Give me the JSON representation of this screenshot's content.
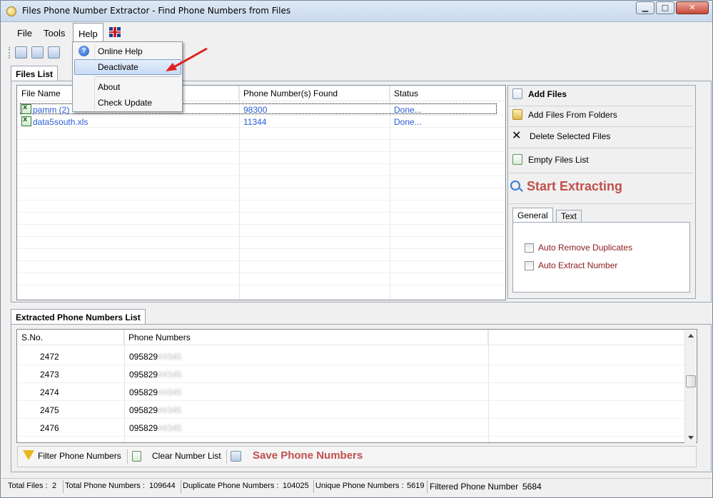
{
  "window": {
    "title": "Files Phone Number Extractor - Find Phone Numbers from Files",
    "min_glyph": "▁",
    "max_glyph": "□",
    "close_glyph": "✕"
  },
  "menu": {
    "file": "File",
    "tools": "Tools",
    "help": "Help",
    "language_icon": "uk-flag-icon"
  },
  "help_menu": {
    "items": [
      {
        "label": "Online Help",
        "icon": "help-icon"
      },
      {
        "label": "Deactivate",
        "highlighted": true
      },
      {
        "label": "About"
      },
      {
        "label": "Check Update"
      }
    ]
  },
  "files_list": {
    "tab_label": "Files List",
    "columns": [
      "File Name",
      "Phone Number(s) Found",
      "Status"
    ],
    "rows": [
      {
        "name": "pamm (2)",
        "found": "98300",
        "status": "Done..."
      },
      {
        "name": "data5south.xls",
        "found": "11344",
        "status": "Done..."
      }
    ]
  },
  "actions": {
    "add_files": "Add Files",
    "add_folders": "Add Files From Folders",
    "delete_selected": "Delete Selected Files",
    "empty_list": "Empty Files List",
    "start": "Start Extracting"
  },
  "options": {
    "tabs": [
      "General",
      "Text"
    ],
    "auto_remove_duplicates": "Auto Remove Duplicates",
    "auto_extract_number": "Auto Extract Number"
  },
  "extracted": {
    "tab_label": "Extracted Phone Numbers List",
    "columns": [
      "S.No.",
      "Phone Numbers"
    ],
    "rows": [
      {
        "sno": "2472",
        "prefix": "095829",
        "hidden": "##345"
      },
      {
        "sno": "2473",
        "prefix": "095829",
        "hidden": "##345"
      },
      {
        "sno": "2474",
        "prefix": "095829",
        "hidden": "##345"
      },
      {
        "sno": "2475",
        "prefix": "095829",
        "hidden": "##345"
      },
      {
        "sno": "2476",
        "prefix": "095829",
        "hidden": "##345"
      }
    ]
  },
  "bottom_toolbar": {
    "filter": "Filter Phone Numbers",
    "clear": "Clear Number List",
    "save": "Save Phone Numbers"
  },
  "status_bar": {
    "total_files_label": "Total Files :",
    "total_files": "2",
    "total_numbers_label": "Total Phone Numbers :",
    "total_numbers": "109644",
    "duplicate_label": "Duplicate Phone Numbers :",
    "duplicate": "104025",
    "unique_label": "Unique Phone Numbers :",
    "unique": "5619",
    "filtered_label": "Filtered Phone Number",
    "filtered": "5684"
  },
  "colors": {
    "accent_red": "#c0504d",
    "link_blue": "#2a5cd6",
    "option_red": "#8b1a1a",
    "arrow_red": "#e02020"
  }
}
